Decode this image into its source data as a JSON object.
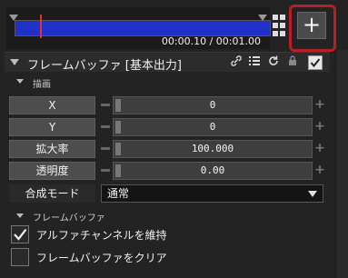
{
  "timeline": {
    "time_text": "00:00.10 / 00:01.00",
    "progress": 0.1
  },
  "toolbar": {
    "add_label": "+"
  },
  "filter": {
    "title": "フレームバッファ [基本出力]",
    "enabled": true
  },
  "draw_section": {
    "title": "描画",
    "properties": [
      {
        "label": "X",
        "value": "0"
      },
      {
        "label": "Y",
        "value": "0"
      },
      {
        "label": "拡大率",
        "value": "100.000"
      },
      {
        "label": "透明度",
        "value": "0.00"
      }
    ],
    "blend_label": "合成モード",
    "blend_value": "通常"
  },
  "fb_section": {
    "title": "フレームバッファ",
    "keep_alpha_label": "アルファチャンネルを維持",
    "keep_alpha_checked": true,
    "clear_label": "フレームバッファをクリア",
    "clear_checked": false
  },
  "colors": {
    "accent_blue": "#2130c8",
    "playhead_red": "#e53030",
    "highlight_red": "#b51f25"
  }
}
